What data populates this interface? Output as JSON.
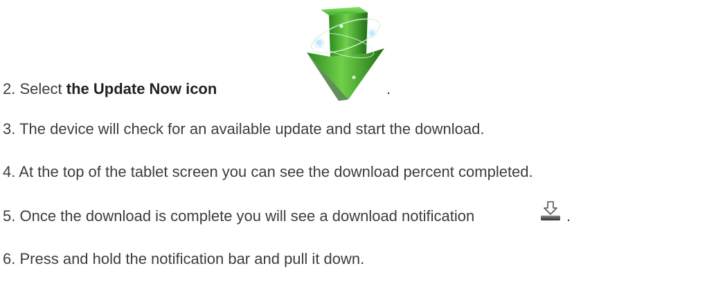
{
  "steps": [
    {
      "number": "2.",
      "text_before": "Select ",
      "bold": "the Update Now icon",
      "text_after": "."
    },
    {
      "number": "3.",
      "text": "The device will check for an available update and start the download."
    },
    {
      "number": "4.",
      "text": "At the top of the tablet screen you can see the download percent completed."
    },
    {
      "number": "5.",
      "text_before": "Once the download is complete you will see a download notification",
      "text_after": "."
    },
    {
      "number": "6.",
      "text": "Press and hold the notification bar and pull it down."
    }
  ],
  "icons": {
    "update_now": "update-now-icon",
    "download_notification": "download-notification-icon"
  },
  "colors": {
    "text": "#3c3c3c",
    "arrow_green": "#3fae2a",
    "arrow_dark": "#1f6e14"
  }
}
